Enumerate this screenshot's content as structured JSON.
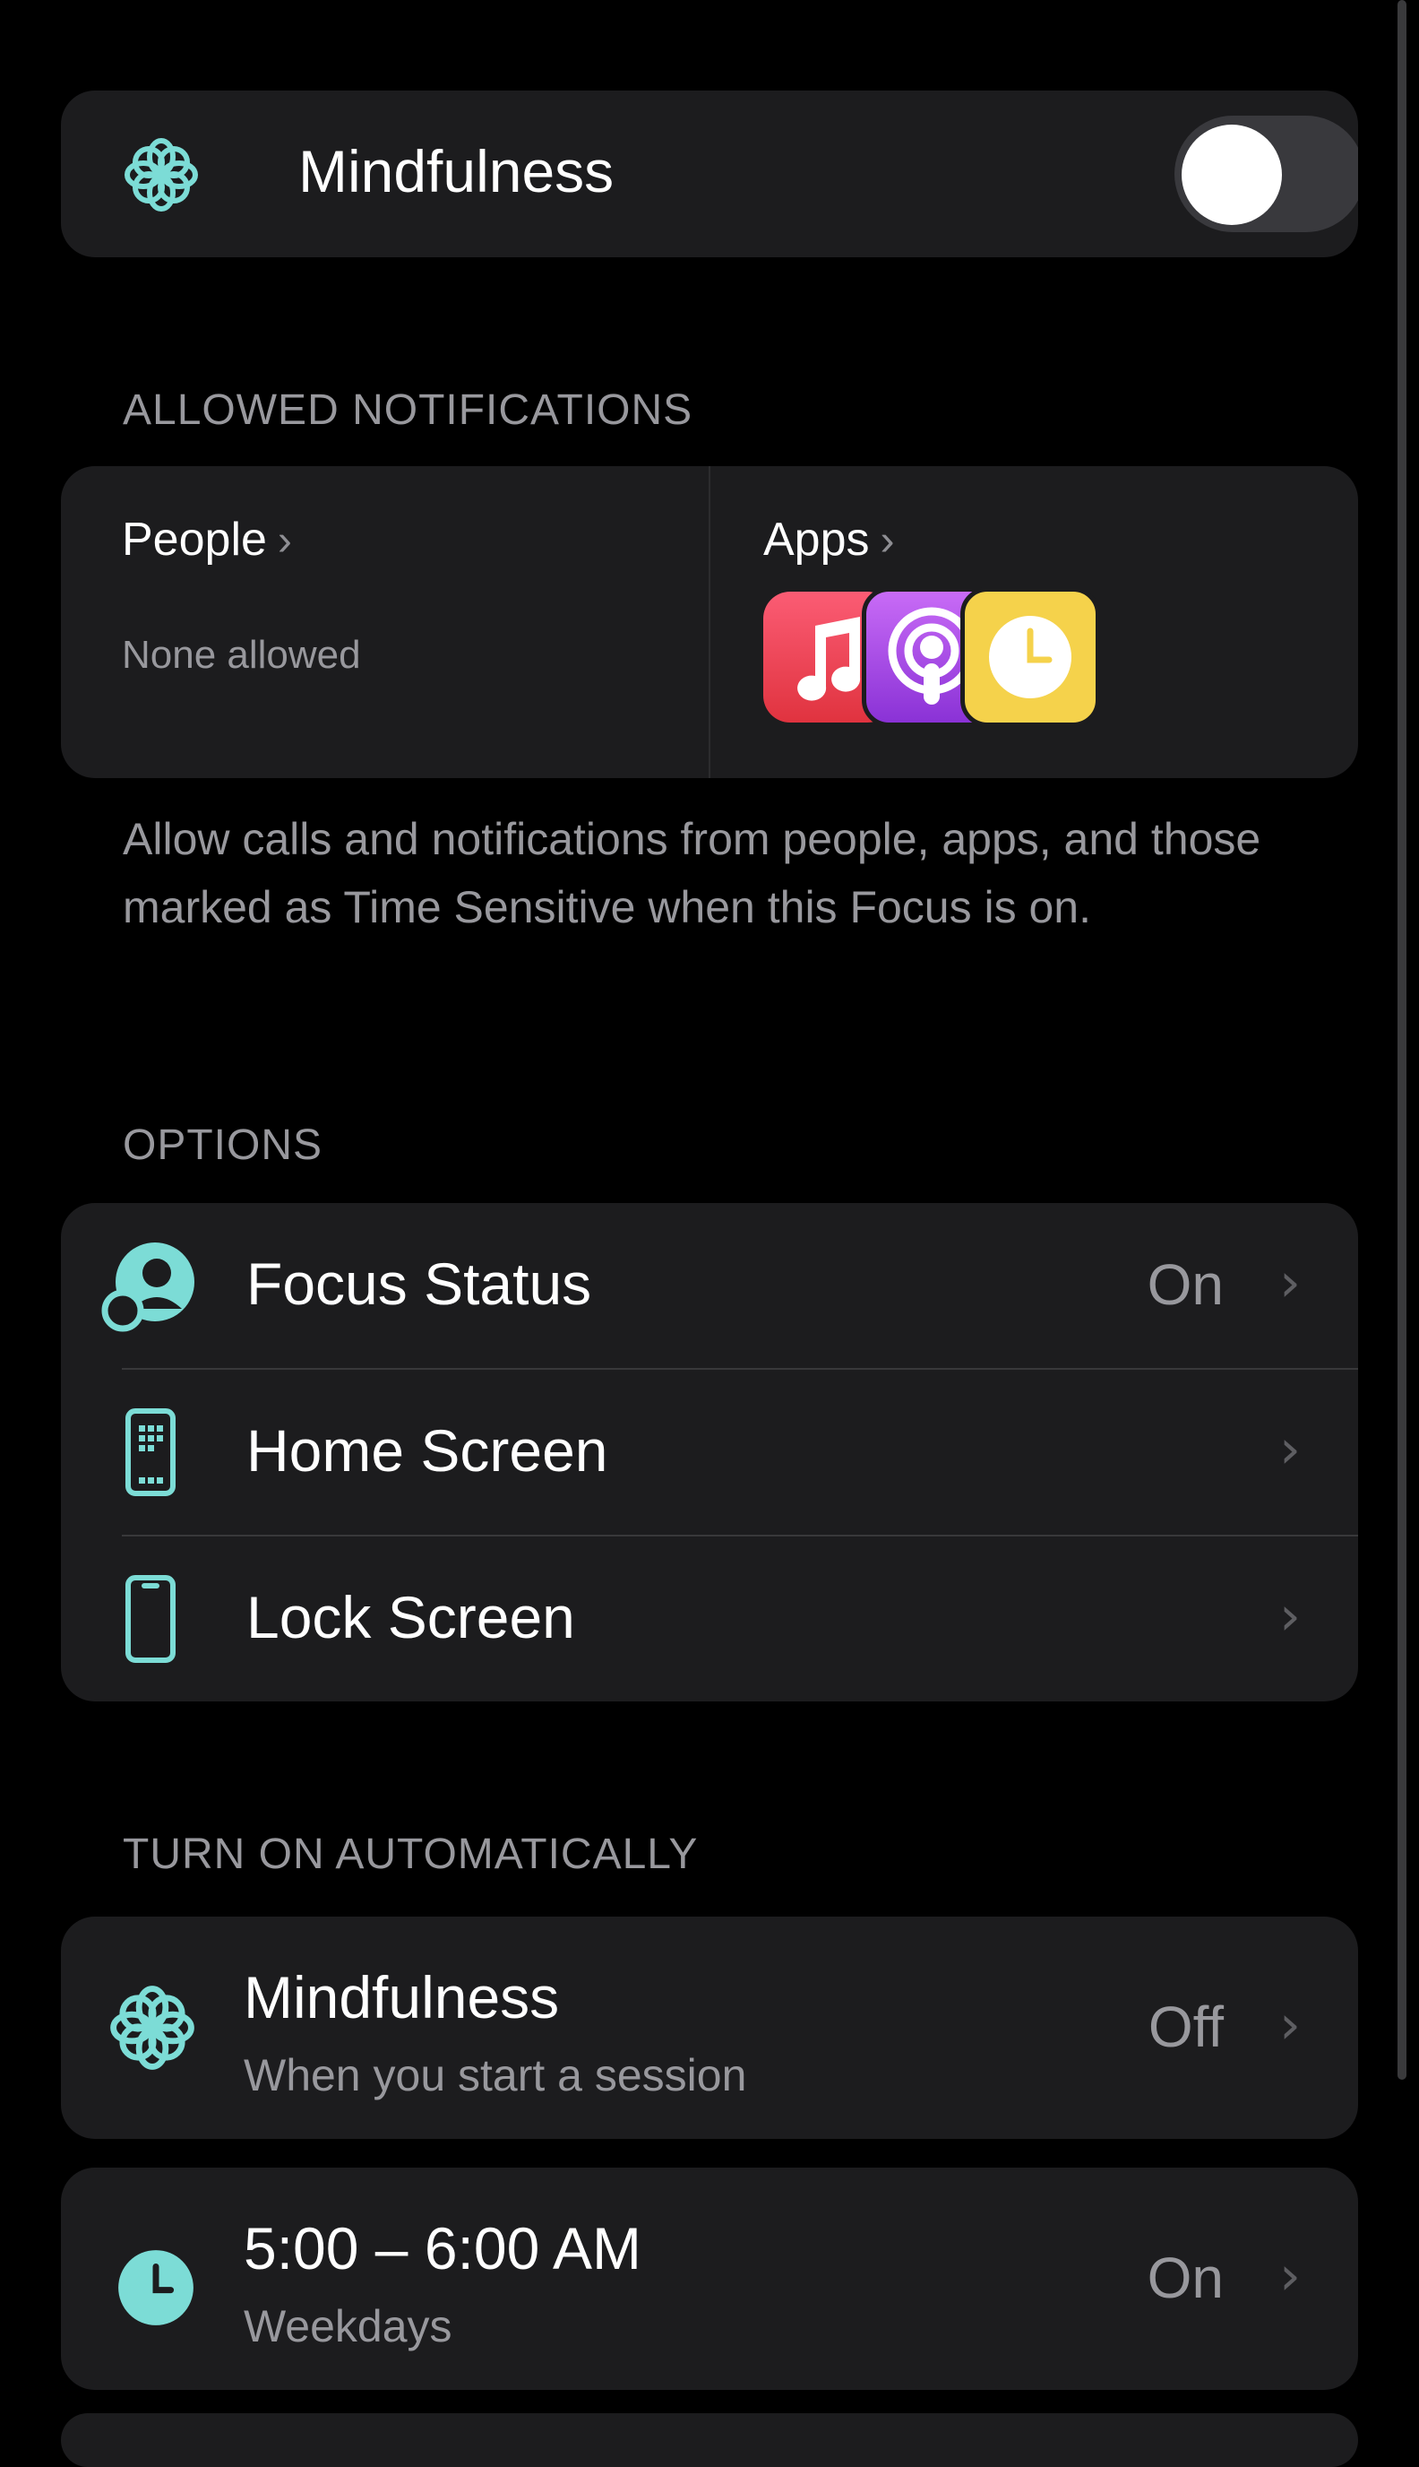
{
  "focus": {
    "title": "Mindfulness",
    "toggle_on": false
  },
  "allowed_notifications": {
    "section_label": "ALLOWED NOTIFICATIONS",
    "people": {
      "label": "People",
      "status": "None allowed"
    },
    "apps": {
      "label": "Apps",
      "icons": [
        "music-app-icon",
        "podcasts-app-icon",
        "clock-app-icon"
      ]
    },
    "footer": "Allow calls and notifications from people, apps, and those marked as Time Sensitive when this Focus is on."
  },
  "options": {
    "section_label": "OPTIONS",
    "items": [
      {
        "label": "Focus Status",
        "value": "On",
        "icon": "focus-status-icon"
      },
      {
        "label": "Home Screen",
        "value": "",
        "icon": "home-screen-icon"
      },
      {
        "label": "Lock Screen",
        "value": "",
        "icon": "lock-screen-icon"
      }
    ]
  },
  "turn_on_automatically": {
    "section_label": "TURN ON AUTOMATICALLY",
    "items": [
      {
        "label": "Mindfulness",
        "sub": "When you start a session",
        "value": "Off",
        "icon": "flower-icon"
      },
      {
        "label": "5:00 – 6:00 AM",
        "sub": "Weekdays",
        "value": "On",
        "icon": "clock-icon"
      }
    ]
  },
  "colors": {
    "accent": "#7cdcd6",
    "card": "#1c1c1e",
    "secondary_text": "#98989d"
  }
}
